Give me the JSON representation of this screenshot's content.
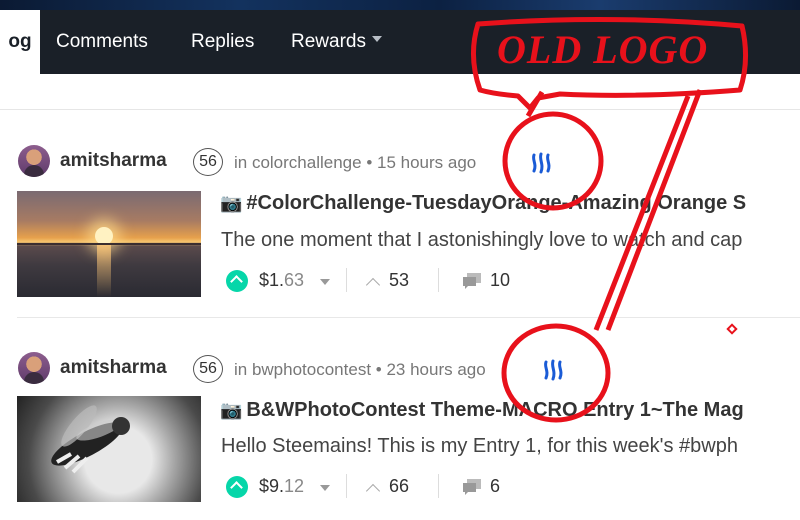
{
  "nav": {
    "tabs": [
      {
        "label": "og",
        "active": true
      },
      {
        "label": "Comments"
      },
      {
        "label": "Replies"
      },
      {
        "label": "Rewards",
        "dropdown": true
      }
    ]
  },
  "annotation": {
    "label": "OLD LOGO",
    "color": "#e8111b"
  },
  "posts": [
    {
      "author": "amitsharma",
      "reputation": "56",
      "category": "in colorchallenge",
      "age": "15 hours ago",
      "title": "#ColorChallenge-TuesdayOrange-Amazing Orange S",
      "excerpt": "The one moment that I astonishingly love to watch and cap",
      "payout_main": "$1.",
      "payout_cents": "63",
      "votes": "53",
      "comments": "10",
      "thumbnail": "sunset"
    },
    {
      "author": "amitsharma",
      "reputation": "56",
      "category": "in bwphotocontest",
      "age": "23 hours ago",
      "title": "B&WPhotoContest Theme-MACRO Entry 1~The Mag",
      "excerpt": "Hello Steemains! This is my Entry 1, for this week's #bwph",
      "payout_main": "$9.",
      "payout_cents": "12",
      "votes": "66",
      "comments": "6",
      "thumbnail": "bw-insect"
    }
  ],
  "colors": {
    "nav_bg": "#1a2028",
    "vote_green": "#06d6a9",
    "steem_blue": "#1a5bd6",
    "annotation_red": "#e8111b"
  }
}
